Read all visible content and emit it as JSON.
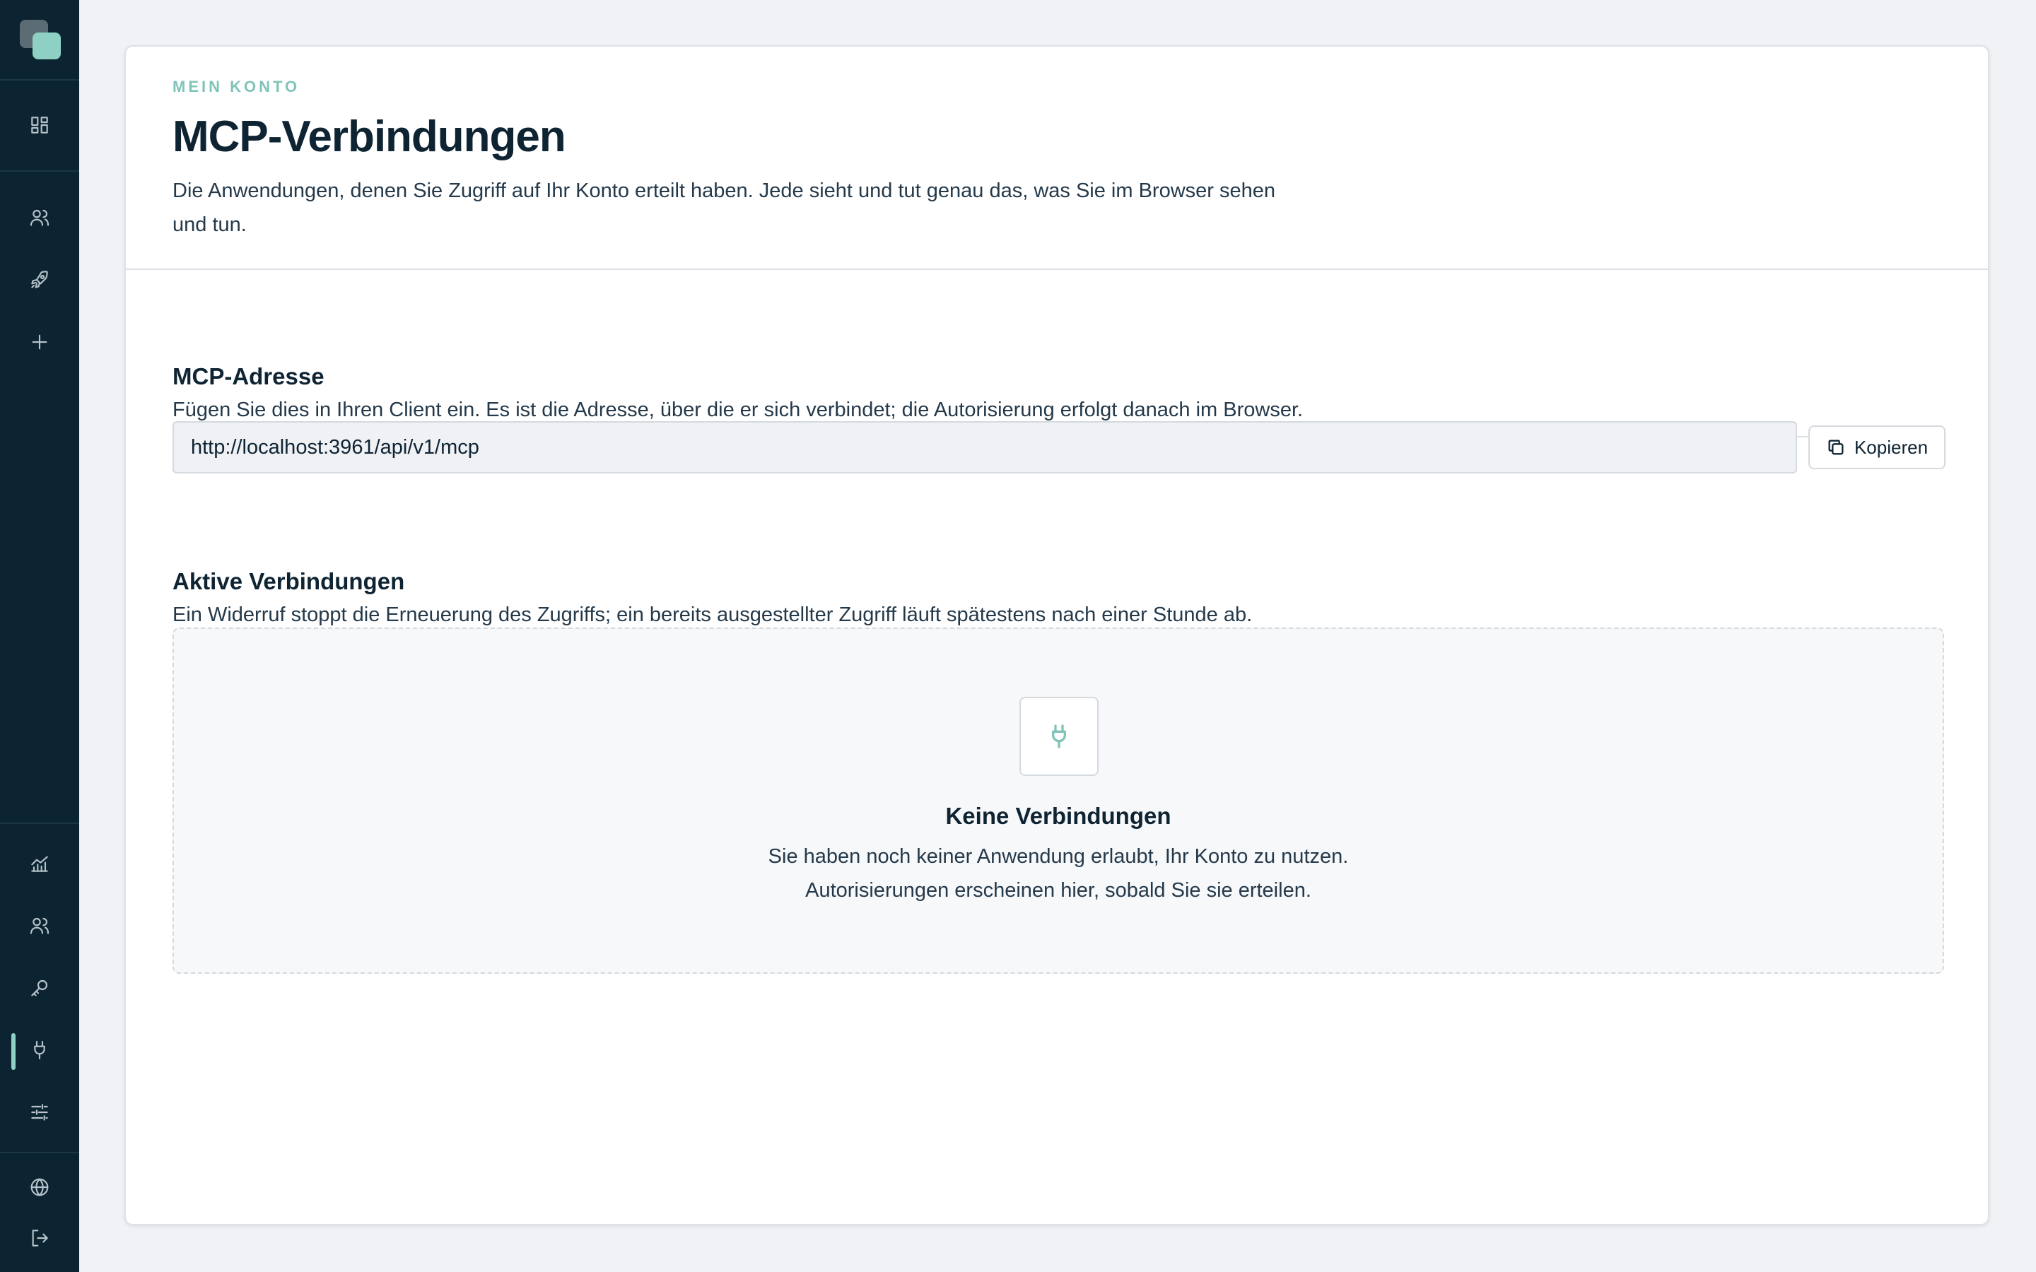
{
  "sidebar": {
    "top_items": [
      {
        "icon": "dashboard-icon"
      },
      {
        "icon": "users-icon"
      },
      {
        "icon": "rocket-icon"
      },
      {
        "icon": "plus-icon"
      }
    ],
    "bottom_items": [
      {
        "icon": "chart-icon"
      },
      {
        "icon": "team-icon"
      },
      {
        "icon": "key-icon"
      },
      {
        "icon": "plug-icon",
        "active": true
      },
      {
        "icon": "sliders-icon"
      },
      {
        "icon": "globe-icon"
      },
      {
        "icon": "logout-icon"
      }
    ],
    "accent_color": "#8fd0c4",
    "background_color": "#0c2431"
  },
  "header": {
    "eyebrow": "MEIN KONTO",
    "title": "MCP-Verbindungen",
    "description": "Die Anwendungen, denen Sie Zugriff auf Ihr Konto erteilt haben. Jede sieht und tut genau das, was Sie im Browser sehen und tun."
  },
  "mcp_address": {
    "title": "MCP-Adresse",
    "description": "Fügen Sie dies in Ihren Client ein. Es ist die Adresse, über die er sich verbindet; die Autorisierung erfolgt danach im Browser.",
    "url": "http://localhost:3961/api/v1/mcp",
    "copy_label": "Kopieren"
  },
  "connections": {
    "title": "Aktive Verbindungen",
    "description": "Ein Widerruf stoppt die Erneuerung des Zugriffs; ein bereits ausgestellter Zugriff läuft spätestens nach einer Stunde ab.",
    "empty_title": "Keine Verbindungen",
    "empty_line1": "Sie haben noch keiner Anwendung erlaubt, Ihr Konto zu nutzen.",
    "empty_line2": "Autorisierungen erscheinen hier, sobald Sie sie erteilen."
  }
}
